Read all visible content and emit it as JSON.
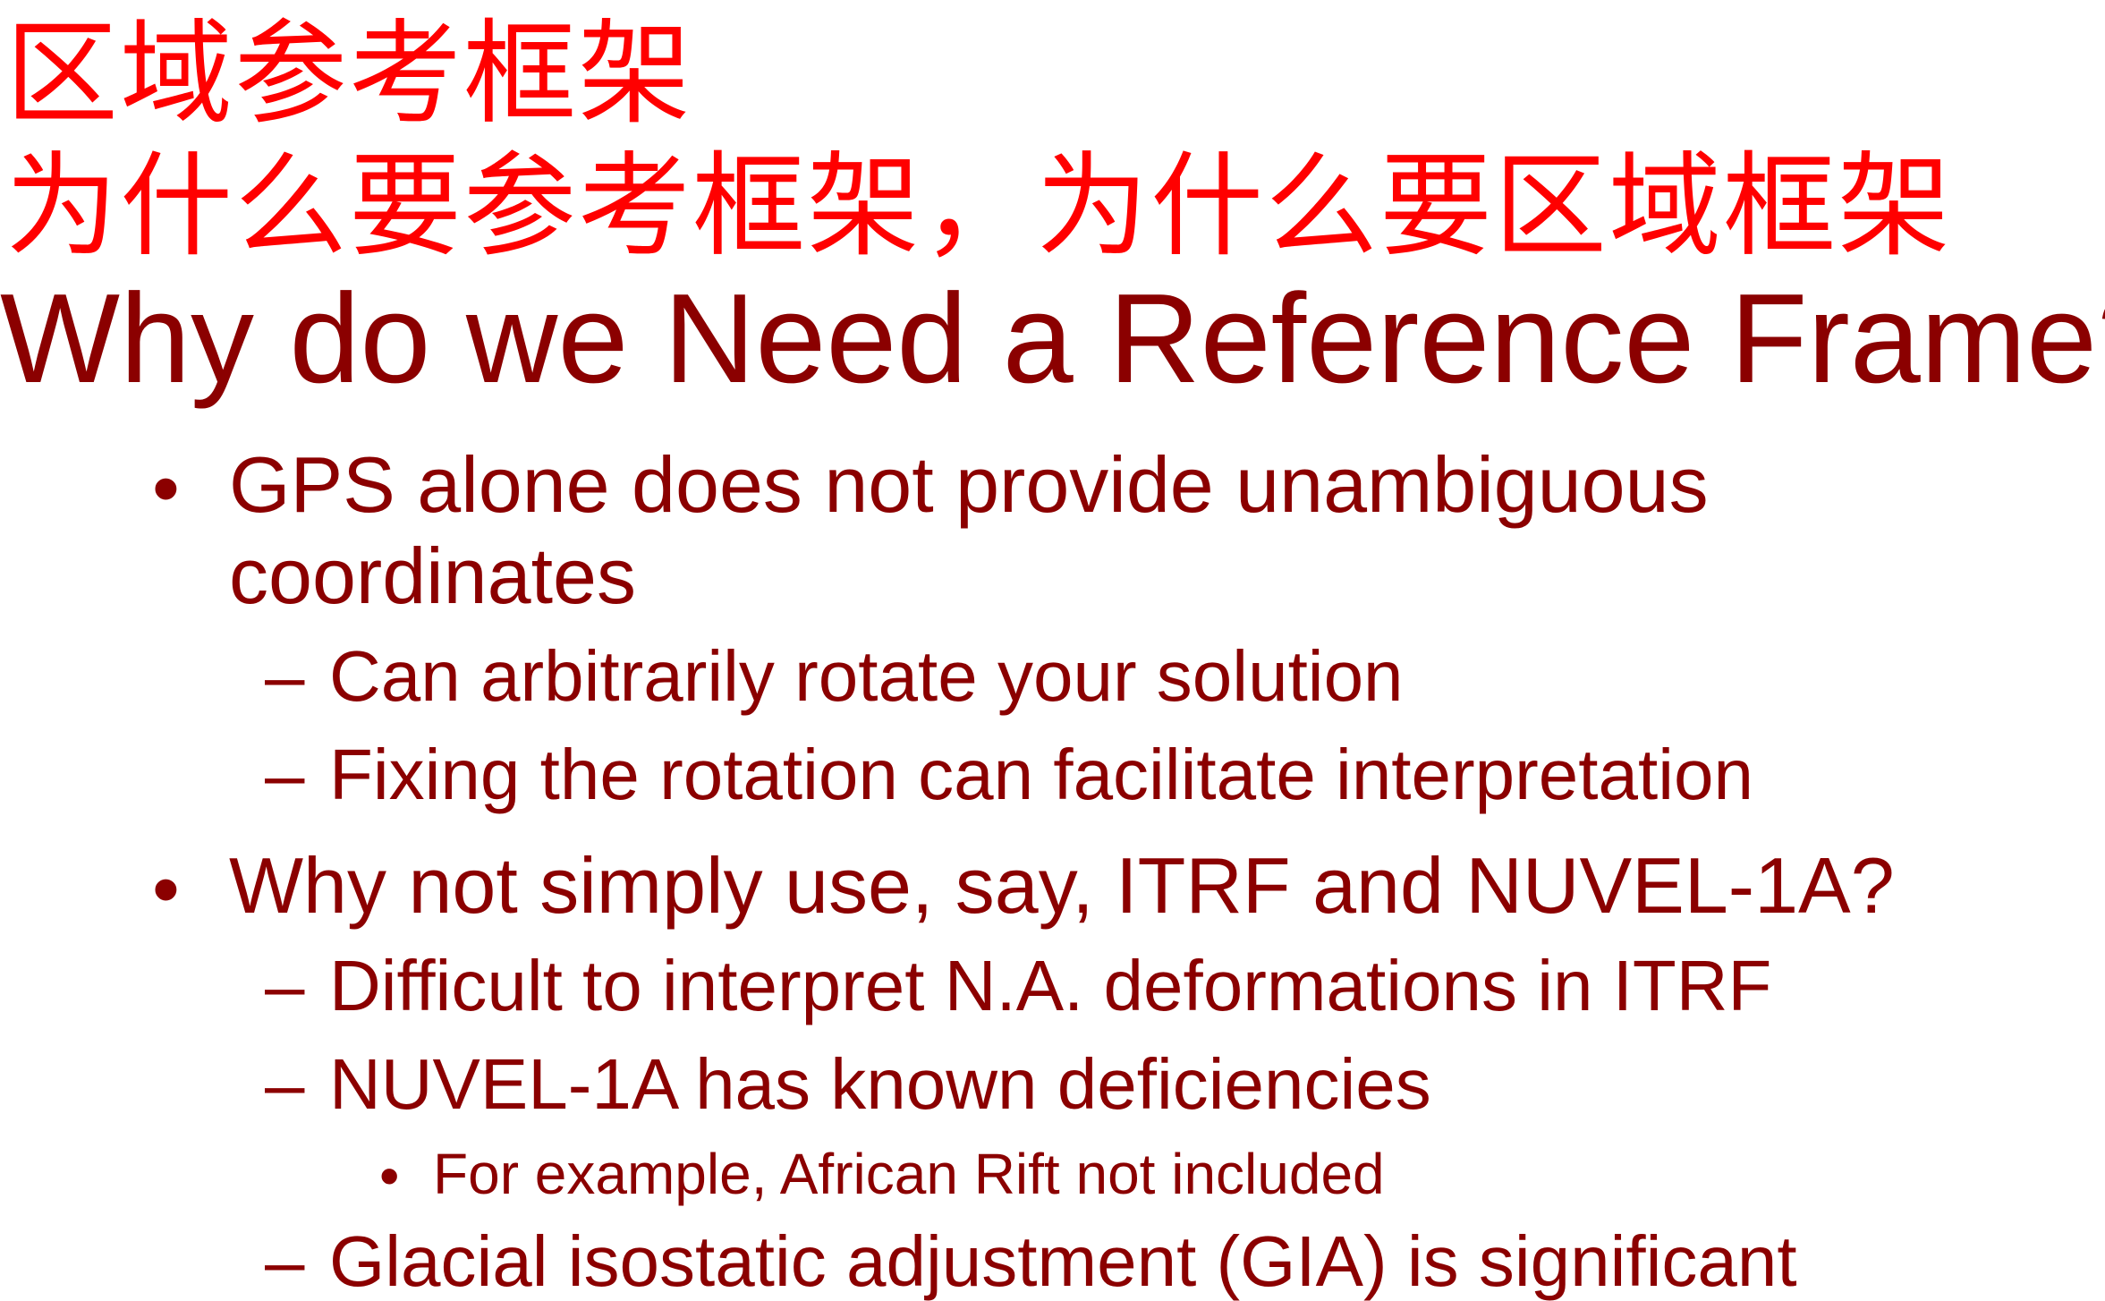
{
  "title": {
    "cn_line1": "区域参考框架",
    "cn_line2": "为什么要参考框架，为什么要区域框架",
    "en": "Why do we Need a Reference Frame?"
  },
  "bullets": {
    "b1": {
      "marker": "•",
      "line1": "GPS alone does not provide unambiguous",
      "line2": "coordinates",
      "subs": [
        {
          "marker": "–",
          "text": "Can arbitrarily rotate your solution"
        },
        {
          "marker": "–",
          "text": "Fixing the rotation can facilitate interpretation"
        }
      ]
    },
    "b2": {
      "marker": "•",
      "text": "Why not simply use, say, ITRF and NUVEL-1A?",
      "subs": [
        {
          "marker": "–",
          "text": "Difficult to interpret N.A. deformations in ITRF"
        },
        {
          "marker": "–",
          "text": "NUVEL-1A has known deficiencies"
        },
        {
          "marker": "•",
          "text": "For example, African Rift not included"
        },
        {
          "marker": "–",
          "text": "Glacial isostatic adjustment (GIA) is significant"
        }
      ]
    }
  },
  "colors": {
    "cn_title": "#ff0000",
    "body": "#8b0000",
    "background": "#ffffff"
  }
}
